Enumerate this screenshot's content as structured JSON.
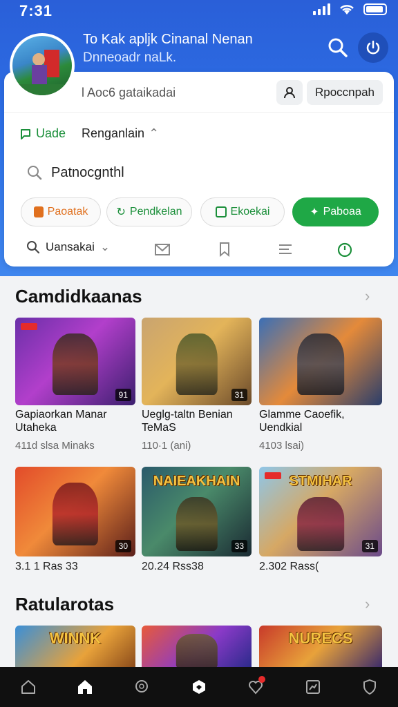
{
  "status": {
    "time": "7:31"
  },
  "header": {
    "title": "To Kak apljk Cinanal Nenan",
    "subtitle": "Dnneoadr naLk."
  },
  "card": {
    "label": "l Aoc6 gataikadai",
    "action_button": "Rpoccnpah",
    "tabs": [
      {
        "label": "Uade",
        "active": true
      },
      {
        "label": "Renganlain"
      }
    ],
    "search_value": "Patnocgnthl",
    "chips": [
      {
        "label": "Paoatak",
        "icon": "tag-icon"
      },
      {
        "label": "Pendkelan",
        "icon": "refresh-icon"
      },
      {
        "label": "Ekoekai",
        "icon": "calendar-icon"
      },
      {
        "label": "Paboaa",
        "icon": "sparkle-icon",
        "active": true
      }
    ],
    "filter": {
      "label": "Uansakai"
    }
  },
  "sections": [
    {
      "title": "Camdidkaanas",
      "games": [
        {
          "title": "Gapiaorkan Manar Utaheka",
          "meta": "411d slsa Minaks",
          "badge": "91"
        },
        {
          "title": "Ueglg-taltn Benian TeMaS",
          "meta": "110·1 (ani)",
          "badge": "31"
        },
        {
          "title": "Glamme Caoefik, Uendkial",
          "meta": "4103 lsai)",
          "badge": ""
        }
      ]
    },
    {
      "title": "",
      "games": [
        {
          "title": "",
          "meta": "3.1 1 Ras 33",
          "badge": "30",
          "logo": ""
        },
        {
          "title": "",
          "meta": "20.24 Rss38",
          "badge": "33",
          "logo": "NAIEAKHAIN"
        },
        {
          "title": "",
          "meta": "2.302 Rass(",
          "badge": "31",
          "logo": "STMIHAR"
        }
      ]
    },
    {
      "title": "Ratularotas",
      "games": [
        {
          "logo": "WINNK"
        },
        {
          "logo": ""
        },
        {
          "logo": "NURECS"
        }
      ]
    }
  ],
  "colors": {
    "brand_blue": "#2d6fe6",
    "accent_green": "#1fa846",
    "accent_orange": "#e0701e"
  }
}
